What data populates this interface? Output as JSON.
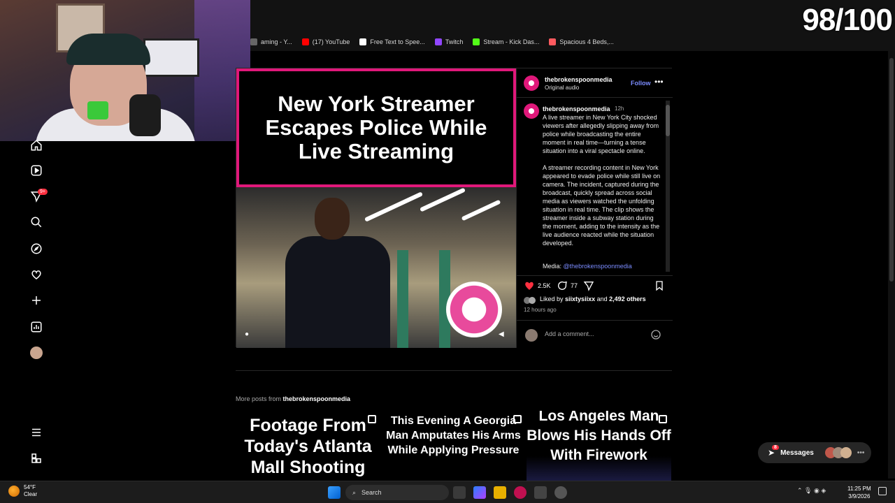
{
  "overlay": {
    "score": "98/100"
  },
  "bookmarks": [
    {
      "label": "aming - Y...",
      "icon": "youtube-studio-icon",
      "color": "#cccccc"
    },
    {
      "label": "(17) YouTube",
      "icon": "youtube-icon",
      "color": "#ff0000"
    },
    {
      "label": "Free Text to Spee...",
      "icon": "tts-icon",
      "color": "#ffffff"
    },
    {
      "label": "Twitch",
      "icon": "twitch-icon",
      "color": "#9146ff"
    },
    {
      "label": "Stream - Kick Das...",
      "icon": "kick-icon",
      "color": "#53fc18"
    },
    {
      "label": "Spacious 4 Beds,...",
      "icon": "airbnb-icon",
      "color": "#ff5a5f"
    }
  ],
  "sidebar": {
    "items": [
      {
        "name": "home-icon"
      },
      {
        "name": "reels-icon"
      },
      {
        "name": "messages-icon",
        "badge": "9+"
      },
      {
        "name": "search-icon"
      },
      {
        "name": "explore-icon"
      },
      {
        "name": "notifications-icon"
      },
      {
        "name": "create-icon"
      },
      {
        "name": "dashboard-icon"
      },
      {
        "name": "profile-avatar"
      },
      {
        "name": "menu-icon"
      },
      {
        "name": "meta-apps-icon"
      }
    ]
  },
  "post": {
    "headline": "New York Streamer Escapes Police While Live Streaming",
    "header": {
      "username": "thebrokenspoonmedia",
      "audio": "Original audio",
      "follow": "Follow",
      "more": "•••"
    },
    "caption": {
      "username": "thebrokenspoonmedia",
      "time": "12h",
      "text": "A live streamer in New York City shocked viewers after allegedly slipping away from police while broadcasting the entire moment in real time—turning a tense situation into a viral spectacle online.\n\nA streamer recording content in New York appeared to evade police while still live on camera. The incident, captured during the broadcast, quickly spread across social media as viewers watched the unfolding situation in real time. The clip shows the streamer inside a subway station during the moment, adding to the intensity as the live audience reacted while the situation developed.",
      "media_label": "Media:",
      "media_handle": "@thebrokenspoonmedia"
    },
    "likes": "2.5K",
    "comments": "77",
    "liked_by_prefix": "Liked by",
    "liked_by_user": "siixtysiixx",
    "liked_by_and": "and",
    "liked_by_others": "2,492 others",
    "time_ago": "12 hours ago",
    "comment_placeholder": "Add a comment..."
  },
  "more_posts": {
    "prefix": "More posts from",
    "username": "thebrokenspoonmedia",
    "thumbs": [
      {
        "text": "Footage From Today's Atlanta Mall Shooting"
      },
      {
        "text": "This Evening A Georgia Man Amputates His Arms While Applying Pressure"
      },
      {
        "text": "Los Angeles Man Blows His Hands Off With Firework"
      }
    ]
  },
  "messages_pill": {
    "label": "Messages",
    "badge": "8"
  },
  "taskbar": {
    "weather_temp": "54°F",
    "weather_desc": "Clear",
    "search": "Search",
    "time": "11:25 PM",
    "date": "3/9/2026"
  }
}
